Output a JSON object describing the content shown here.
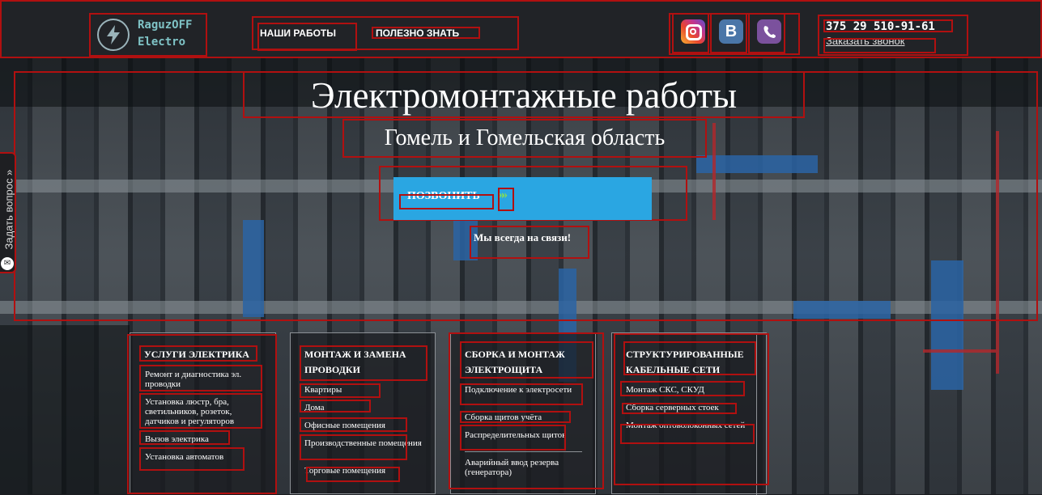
{
  "header": {
    "logo_line1": "RaguzOFF",
    "logo_line2": "Electro",
    "nav": [
      "НАШИ РАБОТЫ",
      "ПОЛЕЗНО ЗНАТЬ"
    ],
    "phone": "375 29 510-91-61",
    "callback": "Заказать звонок",
    "social_icons": [
      "instagram-icon",
      "vk-icon",
      "viber-icon"
    ]
  },
  "hero": {
    "title": "Электромонтажные работы",
    "subtitle": "Гомель и Гомельская область",
    "call_button": "ПОЗВОНИТЬ",
    "call_arrow": "»»",
    "tagline": "Мы всегда на связи!"
  },
  "side_tab": {
    "label": "Задать вопрос »"
  },
  "services": [
    {
      "title": "УСЛУГИ ЭЛЕКТРИКА",
      "items": [
        "Ремонт и диагностика эл. проводки",
        "Установка люстр, бра, светильников, розеток, датчиков и регуляторов",
        "Вызов электрика",
        "Установка автоматов"
      ]
    },
    {
      "title": "МОНТАЖ И ЗАМЕНА ПРОВОДКИ",
      "items": [
        "Квартиры",
        "Дома",
        "Офисные помещения",
        "Производственные помещения",
        "Торговые помещения"
      ]
    },
    {
      "title": "СБОРКА И МОНТАЖ ЭЛЕКТРОЩИТА",
      "items": [
        "Подключение к электросети",
        "Сборка щитов учёта",
        "Распределительных щитов",
        "Аварийный ввод резерва (генератора)"
      ]
    },
    {
      "title": "СТРУКТУРИРОВАННЫЕ КАБЕЛЬНЫЕ СЕТИ",
      "items": [
        "Монтаж СКС, СКУД",
        "Сборка серверных стоек",
        "Монтаж оптоволоконных сетей"
      ]
    }
  ],
  "colors": {
    "header_bg": "#212327",
    "accent_blue": "#2aa6e2",
    "arrow_green": "#8be04c",
    "logo_teal": "#7fc3c6"
  }
}
